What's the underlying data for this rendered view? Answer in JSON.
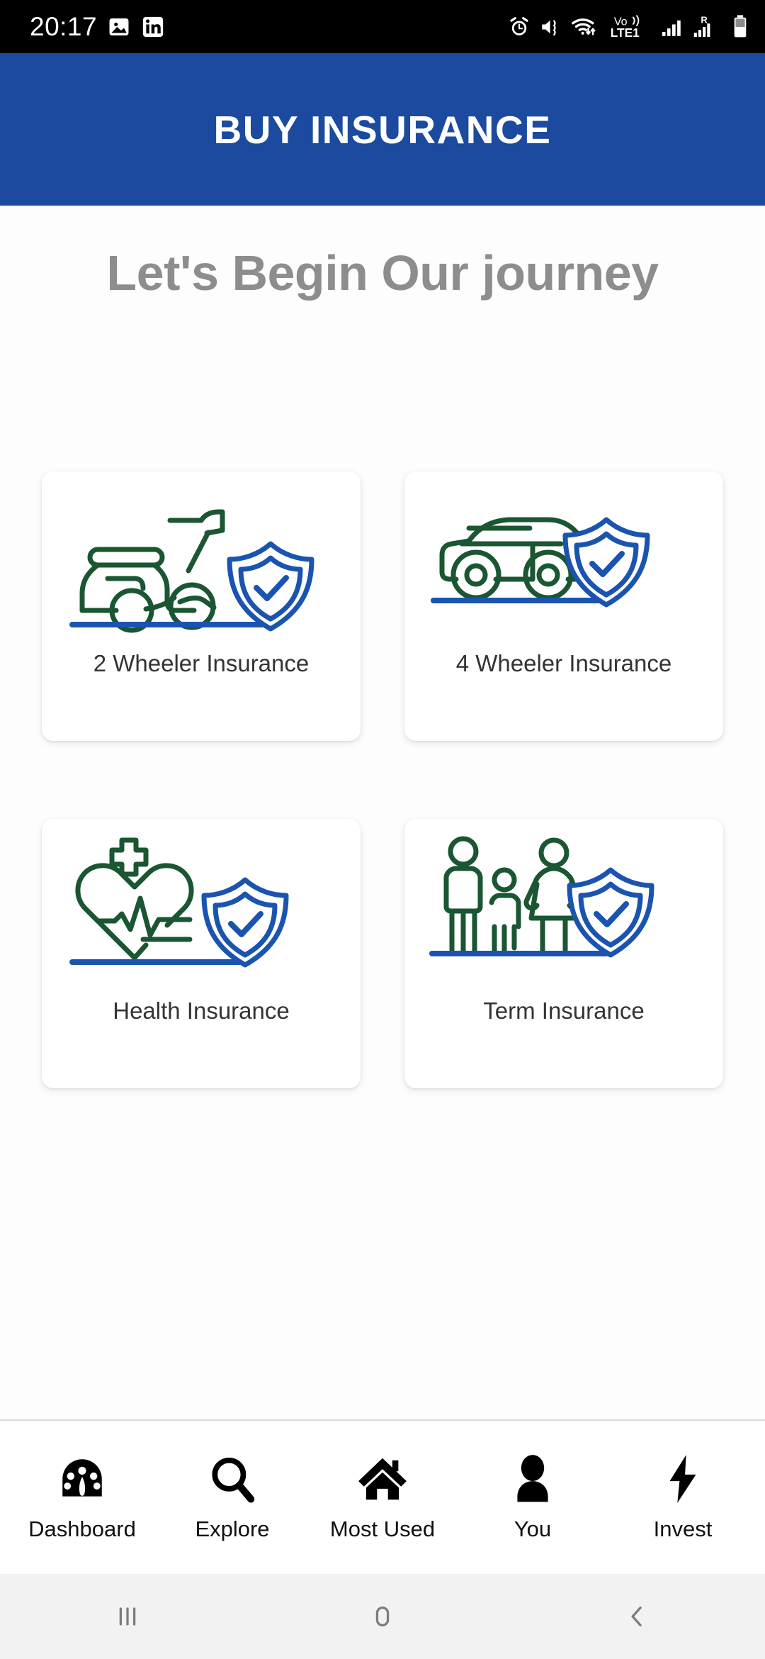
{
  "status_bar": {
    "time": "20:17",
    "left_icons": [
      "image-icon",
      "linkedin-icon"
    ],
    "right_icons": [
      "alarm-icon",
      "mute-vibrate-icon",
      "wifi-data-icon",
      "volte1-icon",
      "signal-bars-icon",
      "roaming-signal-icon",
      "battery-icon"
    ],
    "network_label": "Vo))",
    "network_label2": "LTE1",
    "roaming_label": "R"
  },
  "app_bar": {
    "title": "BUY INSURANCE",
    "background_color": "#1b4a9e",
    "text_color": "#ffffff"
  },
  "main": {
    "heading": "Let's Begin Our journey",
    "heading_color": "#8d8d8d",
    "cards": [
      {
        "label": "2 Wheeler Insurance",
        "icon": "scooter-shield-icon"
      },
      {
        "label": "4 Wheeler Insurance",
        "icon": "car-shield-icon"
      },
      {
        "label": "Health Insurance",
        "icon": "heart-shield-icon"
      },
      {
        "label": "Term Insurance",
        "icon": "family-shield-icon"
      }
    ],
    "icon_green": "#1a5632",
    "icon_blue": "#1a54b0"
  },
  "bottom_nav": {
    "items": [
      {
        "label": "Dashboard",
        "icon": "speedometer-icon"
      },
      {
        "label": "Explore",
        "icon": "search-icon"
      },
      {
        "label": "Most Used",
        "icon": "home-icon"
      },
      {
        "label": "You",
        "icon": "person-icon"
      },
      {
        "label": "Invest",
        "icon": "lightning-bolt-icon"
      }
    ]
  },
  "android_nav": {
    "buttons": [
      "recents-icon",
      "home-icon",
      "back-icon"
    ]
  }
}
